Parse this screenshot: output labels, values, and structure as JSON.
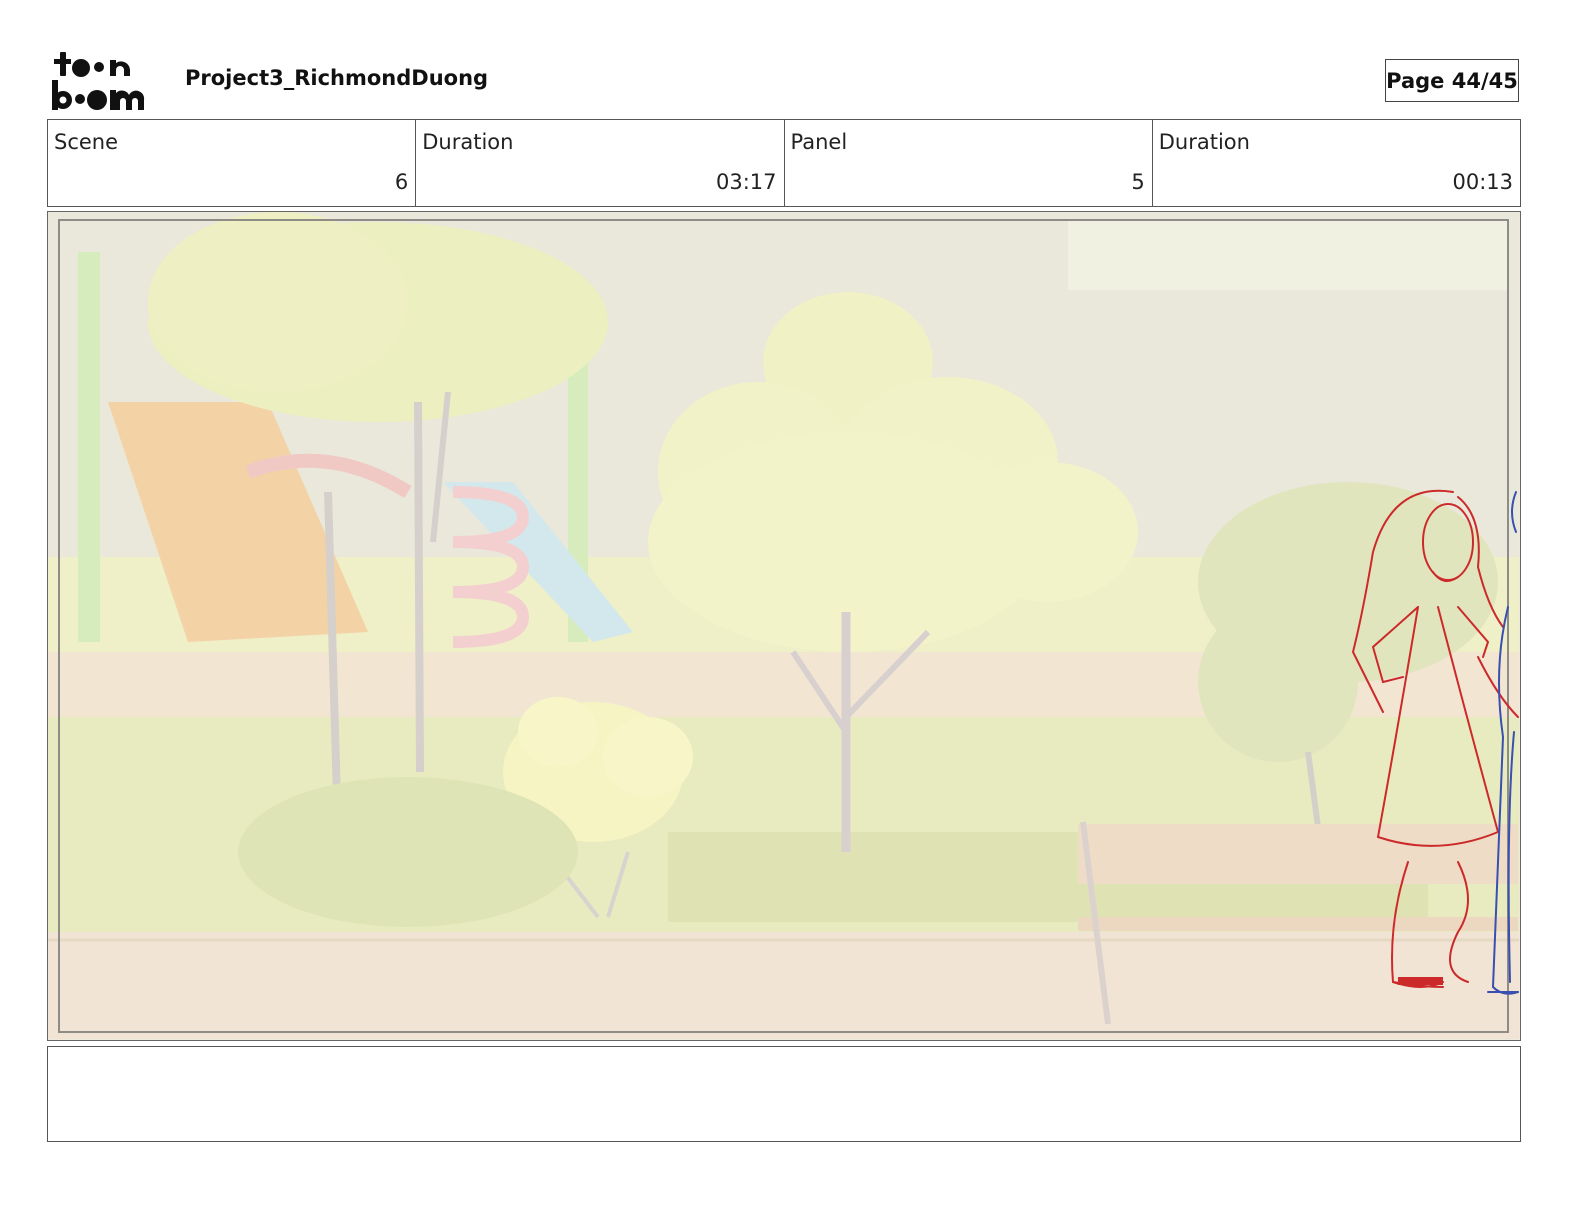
{
  "header": {
    "logo_top": "to•n",
    "logo_bottom": "b••m",
    "project_title": "Project3_RichmondDuong",
    "page_indicator": "Page 44/45"
  },
  "info": {
    "scene_label": "Scene",
    "scene_value": "6",
    "scene_duration_label": "Duration",
    "scene_duration_value": "03:17",
    "panel_label": "Panel",
    "panel_value": "5",
    "panel_duration_label": "Duration",
    "panel_duration_value": "00:13"
  },
  "panel_image": {
    "icon": "storyboard-drawing",
    "sketch_color": "#cc2a2a",
    "second_character_color": "#3a4fb0"
  },
  "notes": {
    "text": ""
  }
}
